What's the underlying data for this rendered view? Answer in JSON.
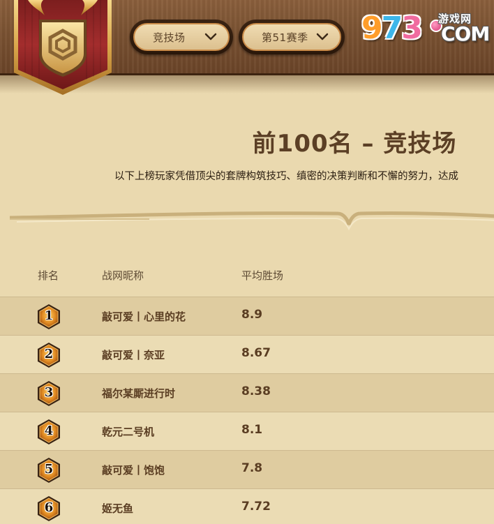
{
  "header": {
    "mode_dropdown": {
      "selected": "竞技场"
    },
    "season_dropdown": {
      "selected": "第51赛季"
    },
    "logo": {
      "digits": [
        "9",
        "7",
        "3"
      ],
      "site": "游戏网",
      "domain": "COM"
    }
  },
  "main": {
    "title": "前100名 – 竞技场",
    "subtitle": "以下上榜玩家凭借顶尖的套牌构筑技巧、缜密的决策判断和不懈的努力，达成"
  },
  "leaderboard": {
    "columns": {
      "rank": "排名",
      "name": "战网昵称",
      "avg_wins": "平均胜场"
    },
    "rows": [
      {
        "rank": "1",
        "name": "敲可爱丨心里的花",
        "avg_wins": "8.9"
      },
      {
        "rank": "2",
        "name": "敲可爱丨奈亚",
        "avg_wins": "8.67"
      },
      {
        "rank": "3",
        "name": "福尔某厮进行时",
        "avg_wins": "8.38"
      },
      {
        "rank": "4",
        "name": "乾元二号机",
        "avg_wins": "8.1"
      },
      {
        "rank": "5",
        "name": "敲可爱丨饱饱",
        "avg_wins": "7.8"
      },
      {
        "rank": "6",
        "name": "姬无鱼",
        "avg_wins": "7.72"
      }
    ]
  },
  "colors": {
    "background": "#ead9af",
    "wood_bar": "#7a5232",
    "banner_red": "#9b2a2a",
    "gold": "#d9a54a",
    "row_even": "#dfcca0",
    "row_odd": "#ebdcb4",
    "text_brown": "#5a3d22"
  },
  "icons": {
    "emblem": "arena-emblem-icon",
    "dropdown_arrow": "chevron-down-icon",
    "rank_badge": "hexagon-rank-badge-icon"
  }
}
